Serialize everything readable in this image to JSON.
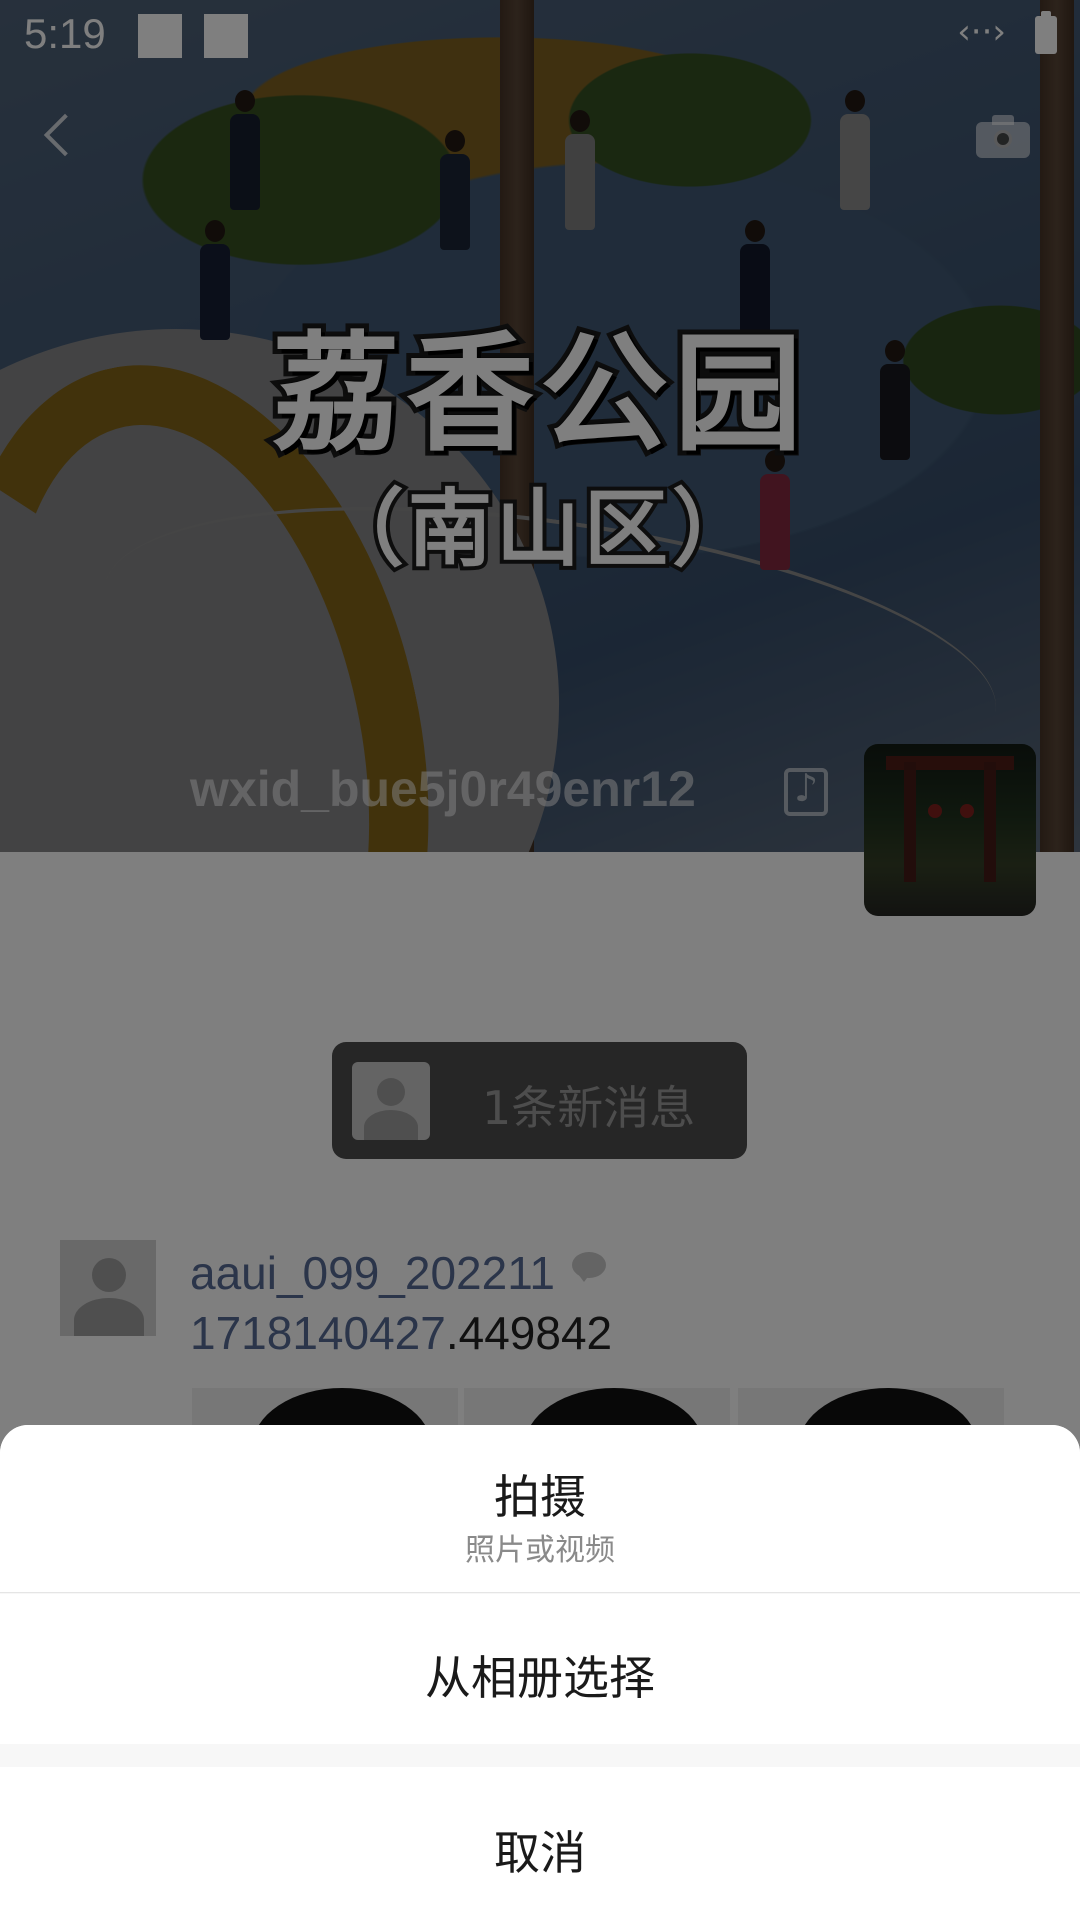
{
  "status_bar": {
    "time": "5:19",
    "data_icon": "data-transfer-icon",
    "battery_icon": "battery-icon"
  },
  "cover": {
    "title": "荔香公园",
    "subtitle": "（南山区）",
    "username": "wxid_bue5j0r49enr12"
  },
  "new_message": {
    "text": "1条新消息"
  },
  "post": {
    "username": "aaui_099_202211",
    "text_link": "1718140427",
    "text_rest": ".449842"
  },
  "action_sheet": {
    "shoot_label": "拍摄",
    "shoot_sub": "照片或视频",
    "album_label": "从相册选择",
    "cancel_label": "取消"
  },
  "colors": {
    "link": "#576b95",
    "overlay": "rgba(0,0,0,0.5)",
    "sheet_background": "#ffffff"
  }
}
